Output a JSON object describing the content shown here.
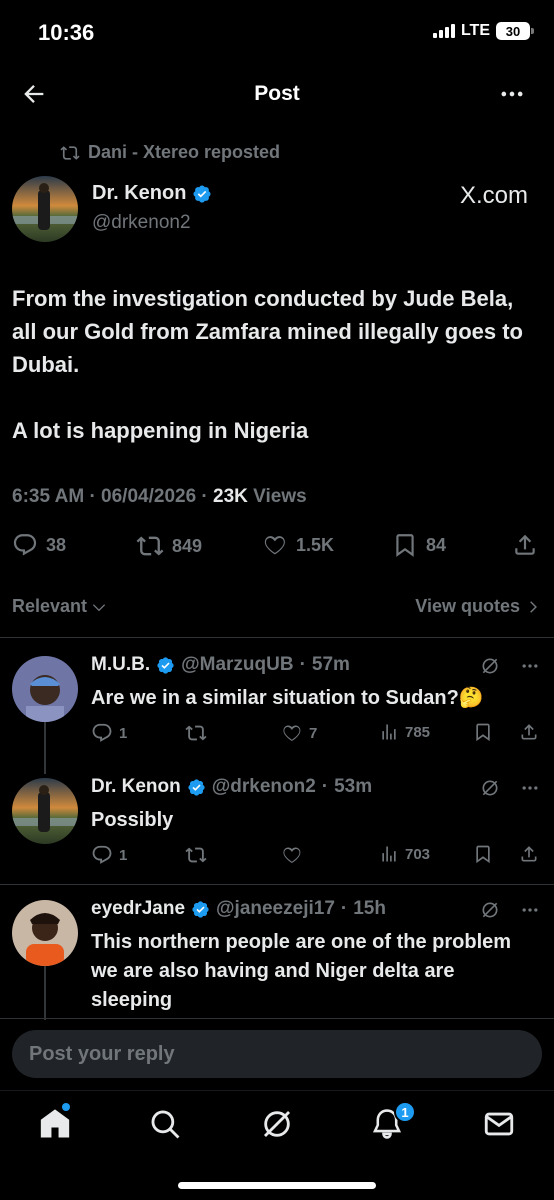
{
  "status_bar": {
    "time": "10:36",
    "network": "LTE",
    "battery": "30"
  },
  "nav": {
    "title": "Post"
  },
  "repost": {
    "text": "Dani - Xtereo reposted"
  },
  "post": {
    "author_name": "Dr. Kenon",
    "handle": "@drkenon2",
    "source": "X.com",
    "paragraphs": [
      "From the investigation conducted by Jude Bela, all our Gold from Zamfara mined illegally goes to Dubai.",
      "A lot is happening in Nigeria"
    ],
    "time": "6:35 AM",
    "date": "06/04/2026",
    "views_count": "23K",
    "views_label": "Views",
    "replies": "38",
    "reposts": "849",
    "likes": "1.5K",
    "bookmarks": "84"
  },
  "sort": {
    "left_label": "Relevant",
    "right_label": "View quotes"
  },
  "replies": [
    {
      "name": "M.U.B.",
      "handle": "@MarzuqUB",
      "time": "57m",
      "text": "Are we in a similar situation to Sudan?🤔",
      "reply_count": "1",
      "repost_count": "",
      "like_count": "7",
      "views": "785"
    },
    {
      "name": "Dr. Kenon",
      "handle": "@drkenon2",
      "time": "53m",
      "text": "Possibly",
      "reply_count": "1",
      "repost_count": "",
      "like_count": "",
      "views": "703"
    },
    {
      "name": "eyedrJane",
      "handle": "@janeezeji17",
      "time": "15h",
      "text": "This northern people are one of the problem we are also having and Niger delta are sleeping"
    }
  ],
  "compose": {
    "placeholder": "Post your reply"
  },
  "tabbar": {
    "notifications_badge": "1"
  },
  "colors": {
    "accent": "#1d9bf0",
    "background": "#000000",
    "text": "#e7e9ea",
    "muted": "#71767b",
    "divider": "#2f3336"
  }
}
